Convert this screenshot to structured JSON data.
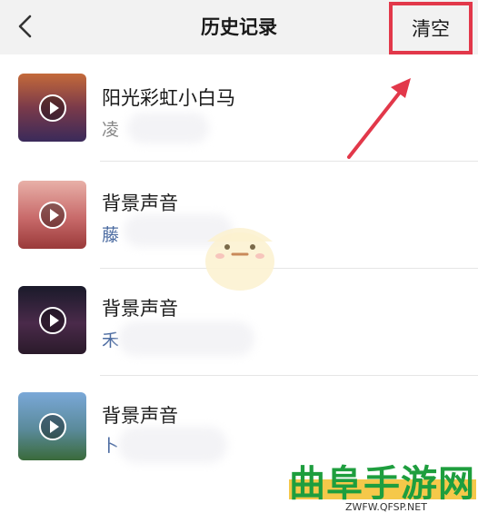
{
  "navbar": {
    "back_icon": "chevron-left-icon",
    "title": "历史记录",
    "clear_label": "清空"
  },
  "items": [
    {
      "title": "阳光彩虹小白马",
      "subtitle": "凌",
      "thumb_color_top": "#c46a3a",
      "thumb_color_bottom": "#3a2a5a",
      "subtitle_color": "#888888"
    },
    {
      "title": "背景声音",
      "subtitle": "藤",
      "thumb_color_top": "#e8a8a8",
      "thumb_color_bottom": "#b54a4a",
      "subtitle_color": "#4a6aa0"
    },
    {
      "title": "背景声音",
      "subtitle": "禾",
      "thumb_color_top": "#1a1a2a",
      "thumb_color_bottom": "#5a3a5a",
      "subtitle_color": "#4a6aa0"
    },
    {
      "title": "背景声音",
      "subtitle": "卜",
      "thumb_color_top": "#7aa8d8",
      "thumb_color_bottom": "#3a6a3a",
      "subtitle_color": "#4a6aa0"
    }
  ],
  "watermark": {
    "name": "曲阜手游网",
    "url": "ZWFW.QFSP.NET"
  },
  "colors": {
    "highlight": "#e2384a",
    "navbar_bg": "#f2f2f2"
  }
}
